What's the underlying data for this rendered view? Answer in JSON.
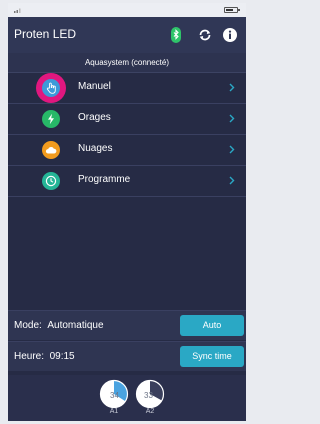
{
  "app": {
    "title": "Proten LED"
  },
  "header": {
    "bluetooth_icon": "bluetooth-icon",
    "refresh_icon": "refresh-icon",
    "info_icon": "info-icon"
  },
  "connection": {
    "status_text": "Aquasystem (connecté)"
  },
  "menu": {
    "items": [
      {
        "label": "Manuel",
        "icon": "hand-pointer-icon",
        "color": "#3b9ad9",
        "selected": true
      },
      {
        "label": "Orages",
        "icon": "lightning-icon",
        "color": "#27b868"
      },
      {
        "label": "Nuages",
        "icon": "cloud-icon",
        "color": "#f29b1e"
      },
      {
        "label": "Programme",
        "icon": "clock-icon",
        "color": "#25b597"
      }
    ]
  },
  "mode": {
    "label": "Mode:",
    "value": "Automatique",
    "button_label": "Auto"
  },
  "time": {
    "label": "Heure:",
    "value": "09:15",
    "button_label": "Sync time"
  },
  "gauges": [
    {
      "value": "34",
      "caption": "A1",
      "level": 0.34
    },
    {
      "value": "33",
      "caption": "A2",
      "level": 0.33
    }
  ],
  "colors": {
    "accent": "#2aa8c5",
    "selection_ring": "#e0177f",
    "background": "#262b45"
  }
}
